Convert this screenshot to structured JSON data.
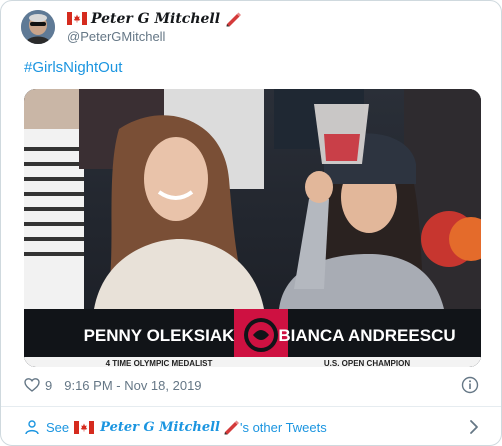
{
  "author": {
    "display_name": "Peter G Mitchell",
    "handle": "@PeterGMitchell",
    "flag_icon": "canada-flag-icon",
    "pencil_icon": "pencil-icon"
  },
  "tweet": {
    "text": "#GirlsNightOut",
    "media": {
      "left_caption": "PENNY OLEKSIAK",
      "right_caption": "BIANCA ANDREESCU",
      "left_subcaption": "4 TIME OLYMPIC MEDALIST",
      "right_subcaption": "U.S. OPEN CHAMPION"
    },
    "likes": "9",
    "timestamp": "9:16 PM - Nov 18, 2019"
  },
  "footer": {
    "see_prefix": "See",
    "see_name": "Peter G Mitchell",
    "see_suffix": "'s other Tweets"
  },
  "colors": {
    "link": "#1b95e0",
    "muted": "#657786",
    "raptors_red": "#ce1141"
  }
}
